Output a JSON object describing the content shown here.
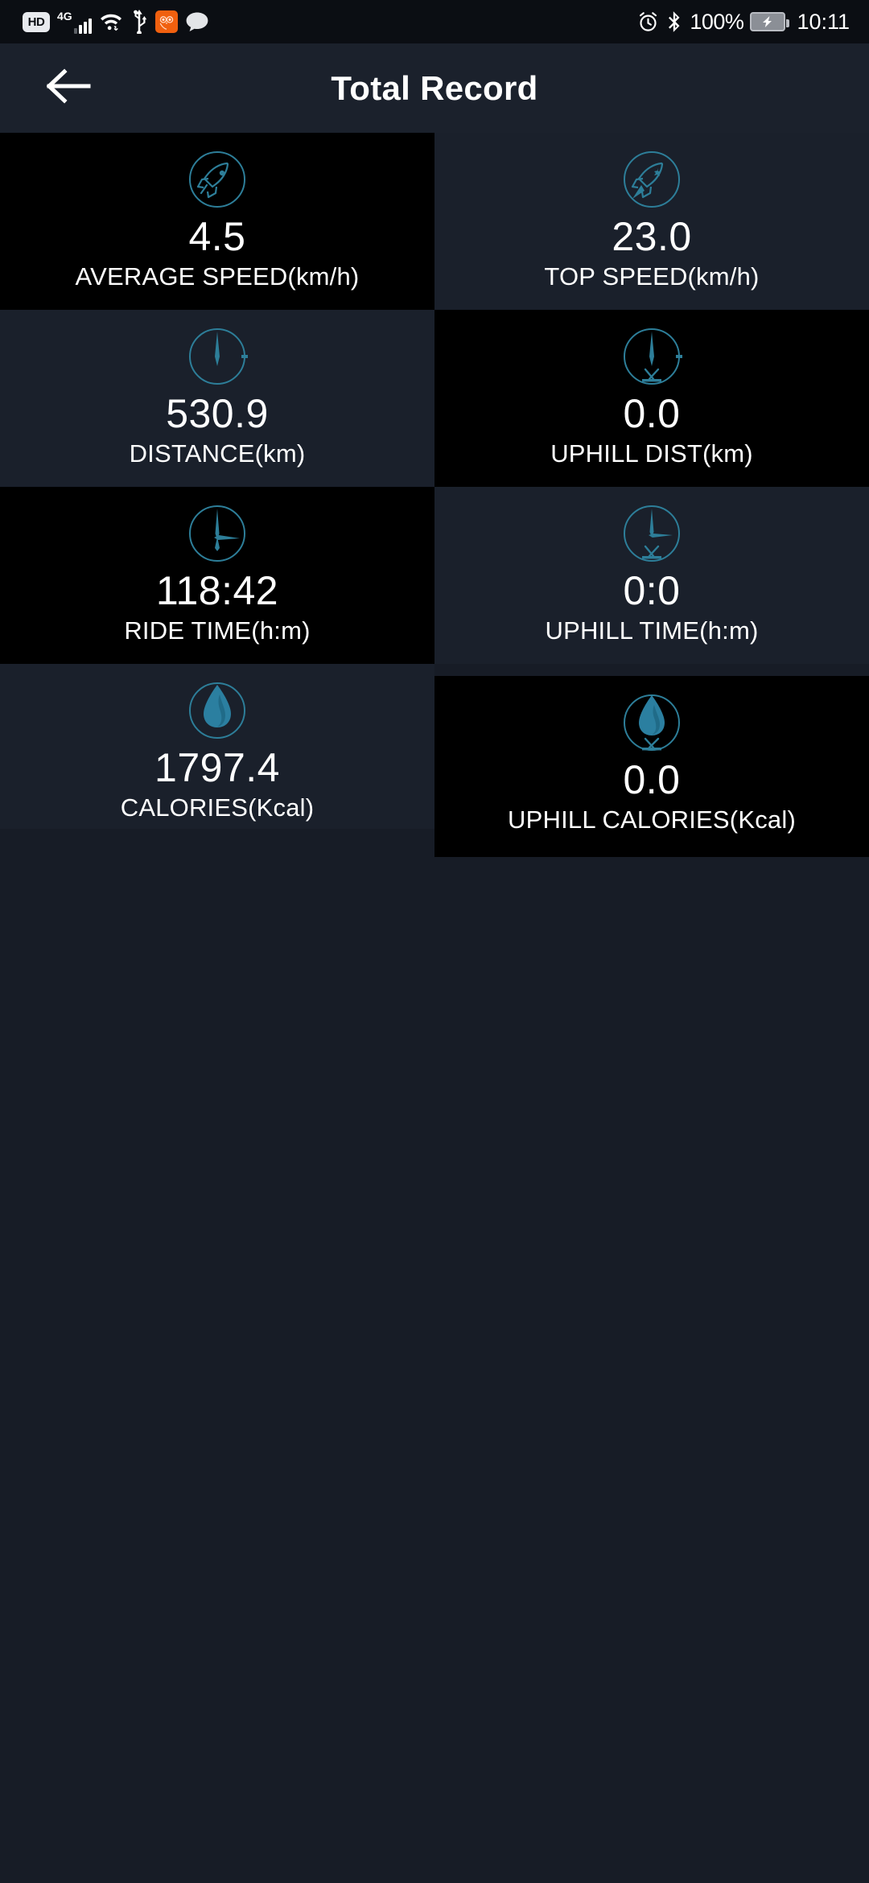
{
  "status_bar": {
    "hd_label": "HD",
    "network_label": "4G",
    "icons_left": [
      "hd-badge",
      "4g-signal-icon",
      "wifi-icon",
      "usb-icon",
      "owl-app-icon",
      "message-bubble-icon"
    ],
    "icons_right": [
      "alarm-clock-icon",
      "bluetooth-icon",
      "battery-charging-icon"
    ],
    "battery_percent": "100%",
    "time": "10:11"
  },
  "app_bar": {
    "back_icon": "arrow-left-icon",
    "title": "Total Record"
  },
  "colors": {
    "accent": "#2b7fa0",
    "icon_stroke": "#2d7e99",
    "cell_dark": "#000000",
    "cell_navy": "#1a202b",
    "page_background": "#171c26",
    "app_bar_background": "#1b212c",
    "text": "#ffffff"
  },
  "stats": [
    {
      "icon": "rocket-outline-icon",
      "value": "4.5",
      "label": "AVERAGE SPEED(km/h)",
      "bg": "dark",
      "col": 0,
      "row": 0
    },
    {
      "icon": "rocket-filled-icon",
      "value": "23.0",
      "label": "TOP SPEED(km/h)",
      "bg": "navy",
      "col": 1,
      "row": 0
    },
    {
      "icon": "distance-gauge-icon",
      "value": "530.9",
      "label": "DISTANCE(km)",
      "bg": "navy",
      "col": 0,
      "row": 1
    },
    {
      "icon": "uphill-distance-icon",
      "value": "0.0",
      "label": "UPHILL DIST(km)",
      "bg": "dark",
      "col": 1,
      "row": 1
    },
    {
      "icon": "ride-time-clock-icon",
      "value": "118:42",
      "label": "RIDE TIME(h:m)",
      "bg": "dark",
      "col": 0,
      "row": 2
    },
    {
      "icon": "uphill-time-clock-icon",
      "value": "0:0",
      "label": "UPHILL TIME(h:m)",
      "bg": "navy",
      "col": 1,
      "row": 2
    },
    {
      "icon": "calories-flame-icon",
      "value": "1797.4",
      "label": "CALORIES(Kcal)",
      "bg": "navy",
      "col": 0,
      "row": 3
    },
    {
      "icon": "uphill-calories-icon",
      "value": "0.0",
      "label": "UPHILL CALORIES(Kcal)",
      "bg": "dark",
      "col": 1,
      "row": 3
    }
  ]
}
